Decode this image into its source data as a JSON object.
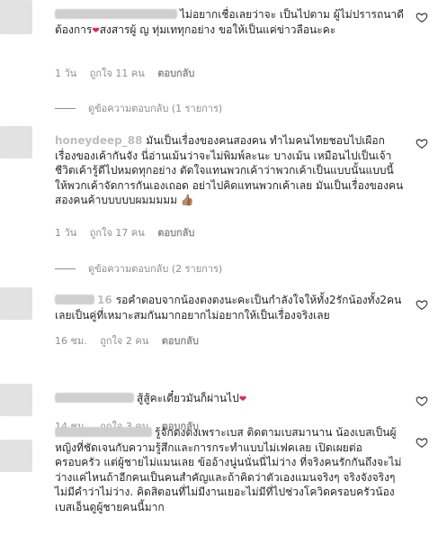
{
  "comments": [
    {
      "text_a": "ไม่อยากเชื่อเลยว่าจะ เป็นไปตาม ผู้ไม่ปรารถนาดีต้องการ",
      "text_b": "สงสารผู้ ญ ทุ่มเททุกอย่าง ขอให้เป็นแค่ข่าวลือนะคะ",
      "time": "1 วัน",
      "likes": "ถูกใจ 11 คน",
      "reply": "ตอบกลับ",
      "view_replies": "ดูข้อความตอบกลับ (1 รายการ)"
    },
    {
      "username": "honeydeep_88",
      "text": "มันเป็นเรื่องของคนสองคน ทำไมคนไทยชอบไปเผือกเรื่องของเค้ากันจัง นี่อ่านเม้นว่าจะไม่พิมพ์ละนะ บางเม้น เหมือนไปเป็นเจ้าชีวิตเค้ารู้ดีไปหมดทุกอย่าง ตัดใจแทนพวกเค้าว่าพวกเค้าเป็นแบบนั้นแบบนี้ ให้พวกเค้าจัดการกันเองเถอด อย่าไปคิดแทนพวกเค้าเลย มันเป็นเรื่องของคนสองคนค้าบบบบบผมมมมม",
      "emoji": "👍🏽",
      "time": "1 วัน",
      "likes": "ถูกใจ 17 คน",
      "reply": "ตอบกลับ",
      "view_replies": "ดูข้อความตอบกลับ (2 รายการ)"
    },
    {
      "username_tail": "16",
      "text": "รอคำตอบจากน้องตงตงนะคะเป็นกำลังใจให้ทั้ง2รักน้องทั้ง2คนเลยเป็นคู่ที่เหมาะสมกันมากอยากไม่อยากให้เป็นเรื่องจริงเลย",
      "time": "16 ชม.",
      "likes": "ถูกใจ 2 คน",
      "reply": "ตอบกลับ"
    },
    {
      "text": "สู้สู้คะเดี๋ยวมันก็ผ่านไป",
      "time": "14 ชม.",
      "likes": "ถูกใจ 3 คน",
      "reply": "ตอบกลับ"
    },
    {
      "text": "รู้จักตงตงเพราะเบส ติดตามเบสมานาน น้องเบสเป็นผู้หญิงที่ชัดเจนกับความรู้สึกและการกระทำแบบไม่เฟคเลย เปิดเผยต่อครอบครัว แต่ผู้ชายไม่แมนเลย ข้ออ้างนู่นนั่นนี่ไม่ว่าง ที่จริงคนรักกันถึงจะไม่ว่างแค่ไหนถ้าอีกคนเป็นคนสำคัญและถ้าคิดว่าตัวเองแมนจริงๆ จริงจังจริงๆ ไม่มีคำว่าไม่ว่าง. คิดสิตอนที่ไม่มีงานเยอะไม่มีที่ไปช่วงโควิดครอบครัวน้องเบสเอ็นดูผู้ชายคนนี้มาก"
    }
  ]
}
